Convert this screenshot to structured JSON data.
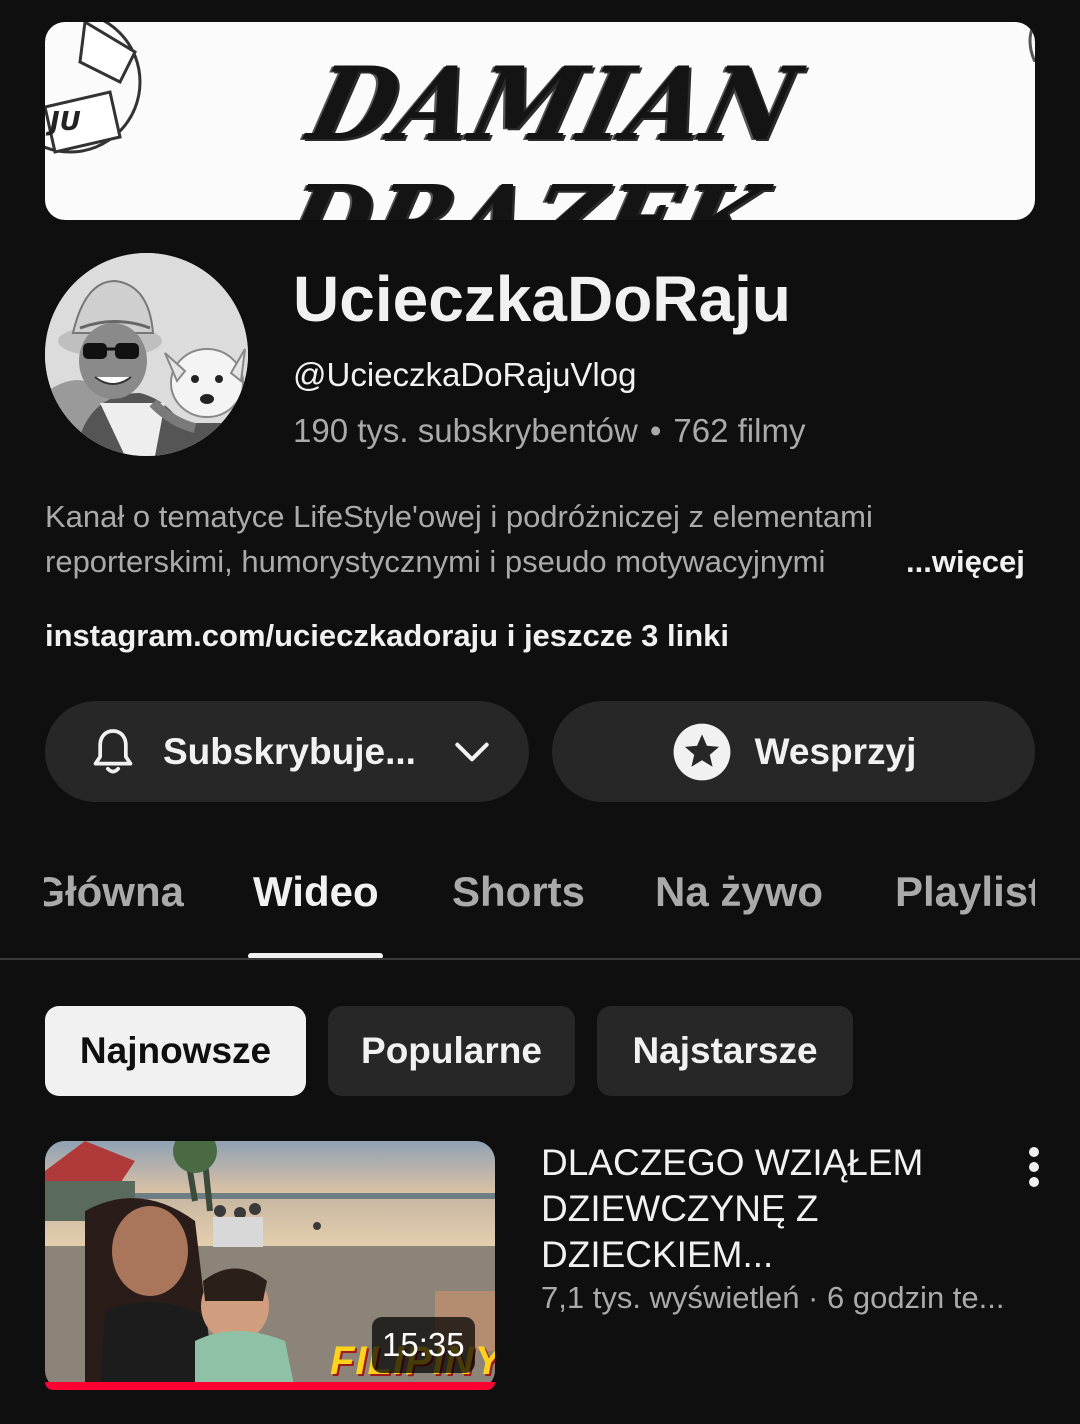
{
  "banner": {
    "text": "DAMIAN DRAZEK"
  },
  "channel": {
    "name": "UcieczkaDoRaju",
    "handle": "@UcieczkaDoRajuVlog",
    "subscribers": "190 tys. subskrybentów",
    "separator": "•",
    "videos": "762 filmy"
  },
  "description": {
    "line1": "Kanał o tematyce LifeStyle'owej i podróżniczej z elementami",
    "line2": "reporterskimi, humorystycznymi i pseudo motywacyjnymi",
    "more": "...więcej"
  },
  "links": {
    "text": "instagram.com/ucieczkadoraju i jeszcze 3 linki"
  },
  "buttons": {
    "subscribe_label": "Subskrybuje...",
    "support_label": "Wesprzyj"
  },
  "tabs": {
    "items": [
      {
        "label": "Główna",
        "active": false
      },
      {
        "label": "Wideo",
        "active": true
      },
      {
        "label": "Shorts",
        "active": false
      },
      {
        "label": "Na żywo",
        "active": false
      },
      {
        "label": "Playlisty",
        "active": false
      }
    ]
  },
  "filters": {
    "chips": [
      {
        "label": "Najnowsze",
        "selected": true
      },
      {
        "label": "Popularne",
        "selected": false
      },
      {
        "label": "Najstarsze",
        "selected": false
      }
    ]
  },
  "video": {
    "title_line1": "DLACZEGO WZIĄŁEM",
    "title_line2": "DZIEWCZYNĘ Z",
    "title_line3": "DZIECKIEM...",
    "meta": "7,1 tys. wyświetleń · 6 godzin te...",
    "duration": "15:35",
    "thumbnail_text": "FILIPINY",
    "watched_fraction": 1.0
  },
  "icons": {
    "subscribe": "bell-icon",
    "subscribe_dropdown": "chevron-down-icon",
    "support": "star-icon",
    "menu": "more-vert-icon"
  },
  "colors": {
    "background": "#0f0f0f",
    "surface": "#272727",
    "text_primary": "#f1f1f1",
    "text_secondary": "#aaaaaa",
    "progress": "#ff0033"
  }
}
